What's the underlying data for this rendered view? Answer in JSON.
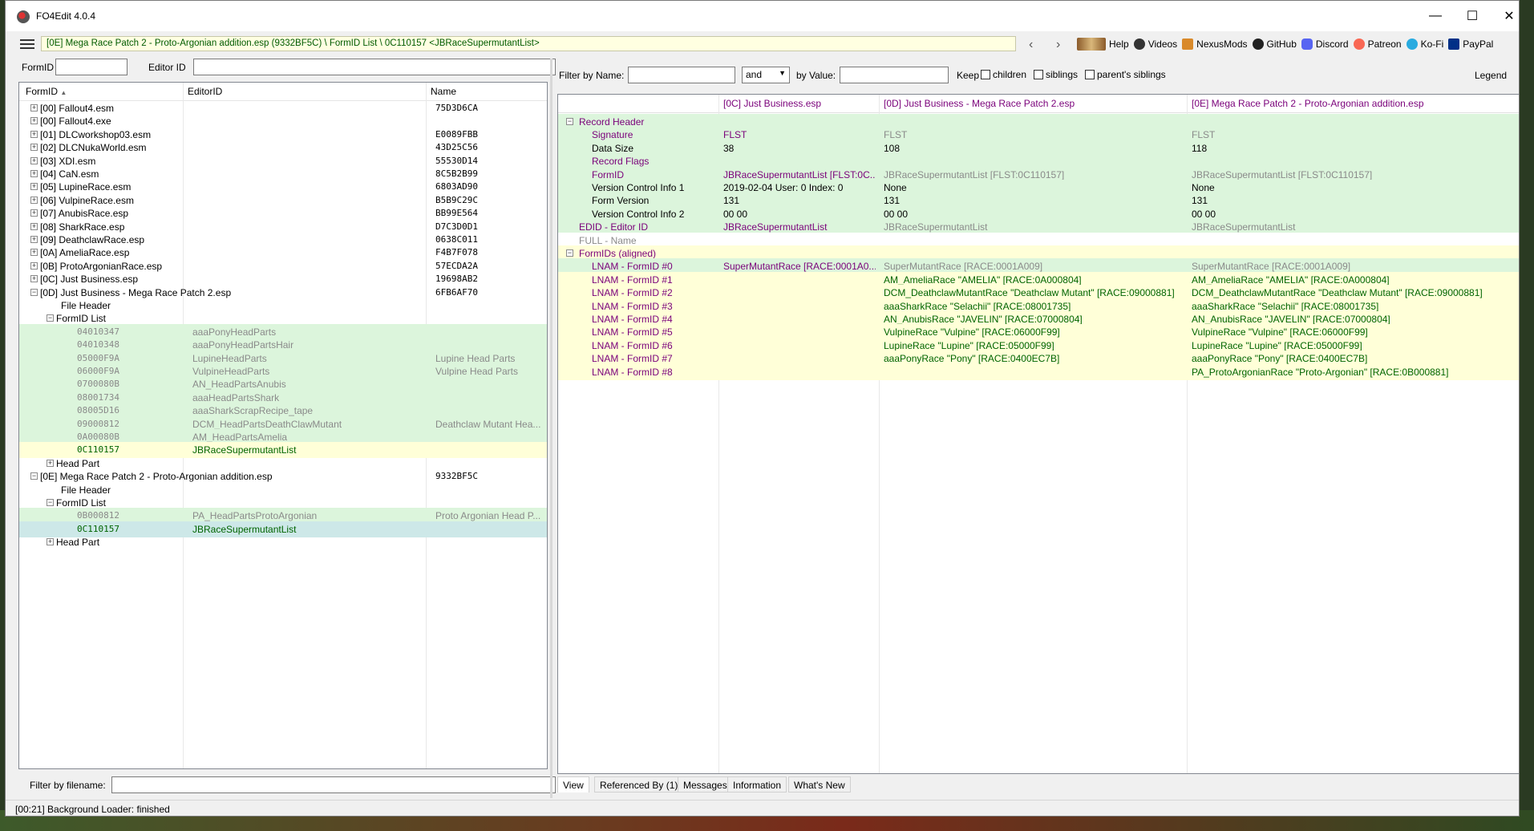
{
  "window": {
    "title": "FO4Edit 4.0.4"
  },
  "toolbar": {
    "path": "[0E] Mega Race Patch 2 - Proto-Argonian addition.esp (9332BF5C) \\ FormID List \\ 0C110157 <JBRaceSupermutantList>",
    "links": [
      "Help",
      "Videos",
      "NexusMods",
      "GitHub",
      "Discord",
      "Patreon",
      "Ko-Fi",
      "PayPal"
    ]
  },
  "left": {
    "formid_label": "FormID",
    "editorid_label": "Editor ID",
    "columns": [
      "FormID",
      "EditorID",
      "Name"
    ],
    "filter_label": "Filter by filename:",
    "rows": [
      {
        "c1": "[00] Fallout4.esm",
        "c3": "75D3D6CA"
      },
      {
        "c1": "[00] Fallout4.exe",
        "c3": ""
      },
      {
        "c1": "[01] DLCworkshop03.esm",
        "c3": "E0089FBB"
      },
      {
        "c1": "[02] DLCNukaWorld.esm",
        "c3": "43D25C56"
      },
      {
        "c1": "[03] XDI.esm",
        "c3": "55530D14"
      },
      {
        "c1": "[04] CaN.esm",
        "c3": "8C5B2B99"
      },
      {
        "c1": "[05] LupineRace.esm",
        "c3": "6803AD90"
      },
      {
        "c1": "[06] VulpineRace.esm",
        "c3": "B5B9C29C"
      },
      {
        "c1": "[07] AnubisRace.esp",
        "c3": "BB99E564"
      },
      {
        "c1": "[08] SharkRace.esp",
        "c3": "D7C3D0D1"
      },
      {
        "c1": "[09] DeathclawRace.esp",
        "c3": "0638C011"
      },
      {
        "c1": "[0A] AmeliaRace.esp",
        "c3": "F4B7F078"
      },
      {
        "c1": "[0B] ProtoArgonianRace.esp",
        "c3": "57ECDA2A"
      },
      {
        "c1": "[0C] Just Business.esp",
        "c3": "19698AB2"
      },
      {
        "c1": "[0D] Just Business - Mega Race Patch 2.esp",
        "c3": "6FB6AF70"
      },
      {
        "c1": "File Header",
        "c3": ""
      },
      {
        "c1": "FormID List",
        "c3": ""
      },
      {
        "c1": "04010347",
        "c2": "aaaPonyHeadParts",
        "c3": ""
      },
      {
        "c1": "04010348",
        "c2": "aaaPonyHeadPartsHair",
        "c3": ""
      },
      {
        "c1": "05000F9A",
        "c2": "LupineHeadParts",
        "c3": "Lupine Head Parts"
      },
      {
        "c1": "06000F9A",
        "c2": "VulpineHeadParts",
        "c3": "Vulpine Head Parts"
      },
      {
        "c1": "0700080B",
        "c2": "AN_HeadPartsAnubis",
        "c3": ""
      },
      {
        "c1": "08001734",
        "c2": "aaaHeadPartsShark",
        "c3": ""
      },
      {
        "c1": "08005D16",
        "c2": "aaaSharkScrapRecipe_tape",
        "c3": ""
      },
      {
        "c1": "09000812",
        "c2": "DCM_HeadPartsDeathClawMutant",
        "c3": "Deathclaw Mutant Hea..."
      },
      {
        "c1": "0A00080B",
        "c2": "AM_HeadPartsAmelia",
        "c3": ""
      },
      {
        "c1": "0C110157",
        "c2": "JBRaceSupermutantList",
        "c3": ""
      },
      {
        "c1": "Head Part",
        "c3": ""
      },
      {
        "c1": "[0E] Mega Race Patch 2 - Proto-Argonian addition.esp",
        "c3": "9332BF5C"
      },
      {
        "c1": "File Header",
        "c3": ""
      },
      {
        "c1": "FormID List",
        "c3": ""
      },
      {
        "c1": "0B000812",
        "c2": "PA_HeadPartsProtoArgonian",
        "c3": "Proto Argonian Head P..."
      },
      {
        "c1": "0C110157",
        "c2": "JBRaceSupermutantList",
        "c3": ""
      },
      {
        "c1": "Head Part",
        "c3": ""
      }
    ]
  },
  "right": {
    "filter_name_label": "Filter by Name:",
    "and_value": "and",
    "by_value_label": "by Value:",
    "keep_label": "Keep",
    "children_label": "children",
    "siblings_label": "siblings",
    "parents_siblings_label": "parent's siblings",
    "legend_label": "Legend",
    "columns": [
      "[0C] Just Business.esp",
      "[0D] Just Business - Mega Race Patch 2.esp",
      "[0E] Mega Race Patch 2 - Proto-Argonian addition.esp"
    ],
    "rows": [
      {
        "label": "Record Header",
        "a": "",
        "b": "",
        "c": ""
      },
      {
        "label": "Signature",
        "a": "FLST",
        "b": "FLST",
        "c": "FLST"
      },
      {
        "label": "Data Size",
        "a": "38",
        "b": "108",
        "c": "118"
      },
      {
        "label": "Record Flags",
        "a": "",
        "b": "",
        "c": ""
      },
      {
        "label": "FormID",
        "a": "JBRaceSupermutantList [FLST:0C...",
        "b": "JBRaceSupermutantList [FLST:0C110157]",
        "c": "JBRaceSupermutantList [FLST:0C110157]"
      },
      {
        "label": "Version Control Info 1",
        "a": "2019-02-04 User: 0 Index: 0",
        "b": "None",
        "c": "None"
      },
      {
        "label": "Form Version",
        "a": "131",
        "b": "131",
        "c": "131"
      },
      {
        "label": "Version Control Info 2",
        "a": "00 00",
        "b": "00 00",
        "c": "00 00"
      },
      {
        "label": "EDID - Editor ID",
        "a": "JBRaceSupermutantList",
        "b": "JBRaceSupermutantList",
        "c": "JBRaceSupermutantList"
      },
      {
        "label": "FULL - Name",
        "a": "",
        "b": "",
        "c": ""
      },
      {
        "label": "FormIDs (aligned)",
        "a": "",
        "b": "",
        "c": ""
      },
      {
        "label": "LNAM - FormID #0",
        "a": "SuperMutantRace [RACE:0001A0...",
        "b": "SuperMutantRace [RACE:0001A009]",
        "c": "SuperMutantRace [RACE:0001A009]"
      },
      {
        "label": "LNAM - FormID #1",
        "a": "",
        "b": "AM_AmeliaRace \"AMELIA\" [RACE:0A000804]",
        "c": "AM_AmeliaRace \"AMELIA\" [RACE:0A000804]"
      },
      {
        "label": "LNAM - FormID #2",
        "a": "",
        "b": "DCM_DeathclawMutantRace \"Deathclaw Mutant\" [RACE:09000881]",
        "c": "DCM_DeathclawMutantRace \"Deathclaw Mutant\" [RACE:09000881]"
      },
      {
        "label": "LNAM - FormID #3",
        "a": "",
        "b": "aaaSharkRace \"Selachii\" [RACE:08001735]",
        "c": "aaaSharkRace \"Selachii\" [RACE:08001735]"
      },
      {
        "label": "LNAM - FormID #4",
        "a": "",
        "b": "AN_AnubisRace \"JAVELIN\" [RACE:07000804]",
        "c": "AN_AnubisRace \"JAVELIN\" [RACE:07000804]"
      },
      {
        "label": "LNAM - FormID #5",
        "a": "",
        "b": "VulpineRace \"Vulpine\" [RACE:06000F99]",
        "c": "VulpineRace \"Vulpine\" [RACE:06000F99]"
      },
      {
        "label": "LNAM - FormID #6",
        "a": "",
        "b": "LupineRace \"Lupine\" [RACE:05000F99]",
        "c": "LupineRace \"Lupine\" [RACE:05000F99]"
      },
      {
        "label": "LNAM - FormID #7",
        "a": "",
        "b": "aaaPonyRace \"Pony\" [RACE:0400EC7B]",
        "c": "aaaPonyRace \"Pony\" [RACE:0400EC7B]"
      },
      {
        "label": "LNAM - FormID #8",
        "a": "",
        "b": "",
        "c": "PA_ProtoArgonianRace \"Proto-Argonian\" [RACE:0B000881]"
      }
    ],
    "tabs": [
      "View",
      "Referenced By (1)",
      "Messages",
      "Information",
      "What's New"
    ]
  },
  "status": {
    "text": "[00:21] Background Loader: finished"
  }
}
